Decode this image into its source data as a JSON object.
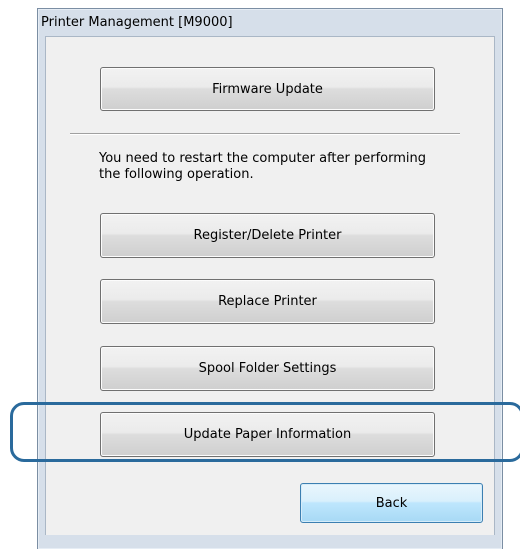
{
  "window": {
    "title": "Printer Management [M9000]"
  },
  "buttons": {
    "firmware_update": "Firmware Update",
    "register_delete_printer": "Register/Delete Printer",
    "replace_printer": "Replace Printer",
    "spool_folder_settings": "Spool Folder Settings",
    "update_paper_information": "Update Paper Information",
    "back": "Back"
  },
  "notice": {
    "restart_message": "You need to restart the computer after performing the following operation."
  },
  "colors": {
    "highlight_outline": "#2a6a9c",
    "default_button_border": "#3c7fb1"
  }
}
